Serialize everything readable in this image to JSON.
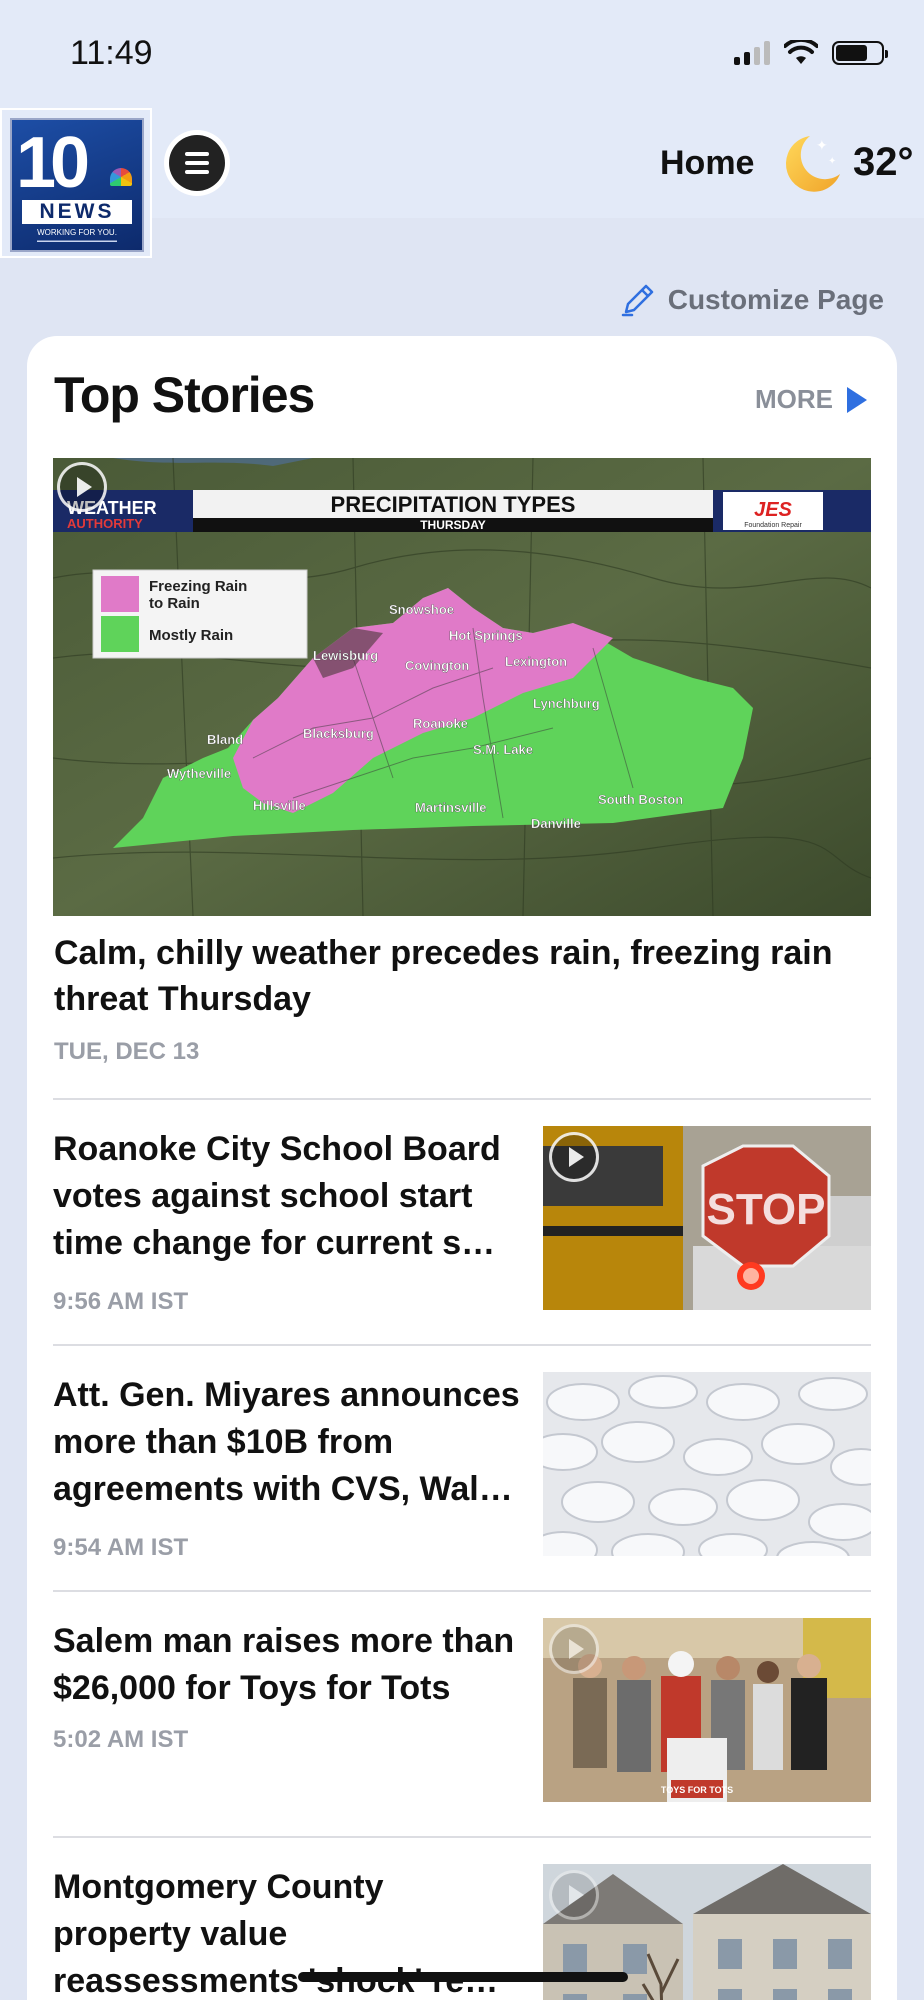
{
  "status_bar": {
    "time": "11:49"
  },
  "header": {
    "logo_number": "10",
    "logo_news": "NEWS",
    "logo_tagline": "WORKING FOR YOU.",
    "home_label": "Home",
    "temperature": "32°"
  },
  "customize": {
    "label": "Customize Page"
  },
  "top_stories": {
    "title": "Top Stories",
    "more_label": "MORE",
    "hero": {
      "title": "Calm, chilly weather precedes rain, freezing rain threat Thursday",
      "date": "TUE, DEC 13",
      "graphic": {
        "brand": "WEATHER AUTHORITY",
        "heading": "PRECIPITATION TYPES",
        "subheading": "THURSDAY",
        "sponsor": "JES",
        "sponsor_sub": "Foundation Repair",
        "legend": [
          "Freezing Rain to Rain",
          "Mostly Rain"
        ],
        "places": [
          "Snowshoe",
          "Hot Springs",
          "Lewisburg",
          "Covington",
          "Lexington",
          "Lynchburg",
          "Bland",
          "Blacksburg",
          "Roanoke",
          "S.M. Lake",
          "Wytheville",
          "Hillsville",
          "Martinsville",
          "South Boston",
          "Danville"
        ]
      }
    },
    "stories": [
      {
        "title": "Roanoke City School Board votes against school start time change for current s…",
        "time": "9:56 AM IST",
        "thumb_text": "STOP"
      },
      {
        "title": "Att. Gen. Miyares announces more than $10B from agreements with CVS, Wal…",
        "time": "9:54 AM IST"
      },
      {
        "title": "Salem man raises more than $26,000 for Toys for Tots",
        "time": "5:02 AM IST",
        "thumb_text": "TOYS FOR TOTS"
      },
      {
        "title": "Montgomery County property value reassessments 'shock' re…",
        "time": ""
      }
    ]
  },
  "colors": {
    "accent": "#2f6fe0",
    "background": "#dfe5f3",
    "freezing_rain": "#e07ac8",
    "mostly_rain": "#5fd35a"
  }
}
